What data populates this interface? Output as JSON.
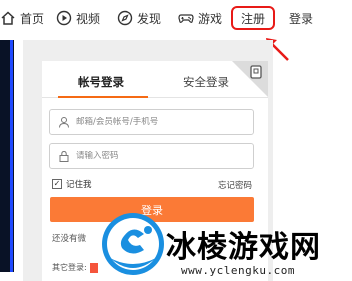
{
  "nav": {
    "home": "首页",
    "video": "视频",
    "discover": "发现",
    "game": "游戏",
    "register": "注册",
    "login": "登录"
  },
  "login_card": {
    "tabs": [
      "帐号登录",
      "安全登录"
    ],
    "active_tab": "帐号登录",
    "username_placeholder": "邮箱/会员帐号/手机号",
    "password_placeholder": "请输入密码",
    "remember_label": "记住我",
    "remember_checked": true,
    "forgot_label": "忘记密码",
    "login_button": "登录",
    "no_account_text": "还没有微",
    "other_login_label": "其它登录:"
  },
  "watermark": {
    "brand": "冰棱游戏网",
    "url": "www.yclengku.com"
  },
  "colors": {
    "accent_orange": "#fb7a36",
    "register_highlight": "#e81a17",
    "left_panel": "#091226",
    "left_panel_stripe": "#1f49ff",
    "logo_blue": "#1a8fe0"
  }
}
